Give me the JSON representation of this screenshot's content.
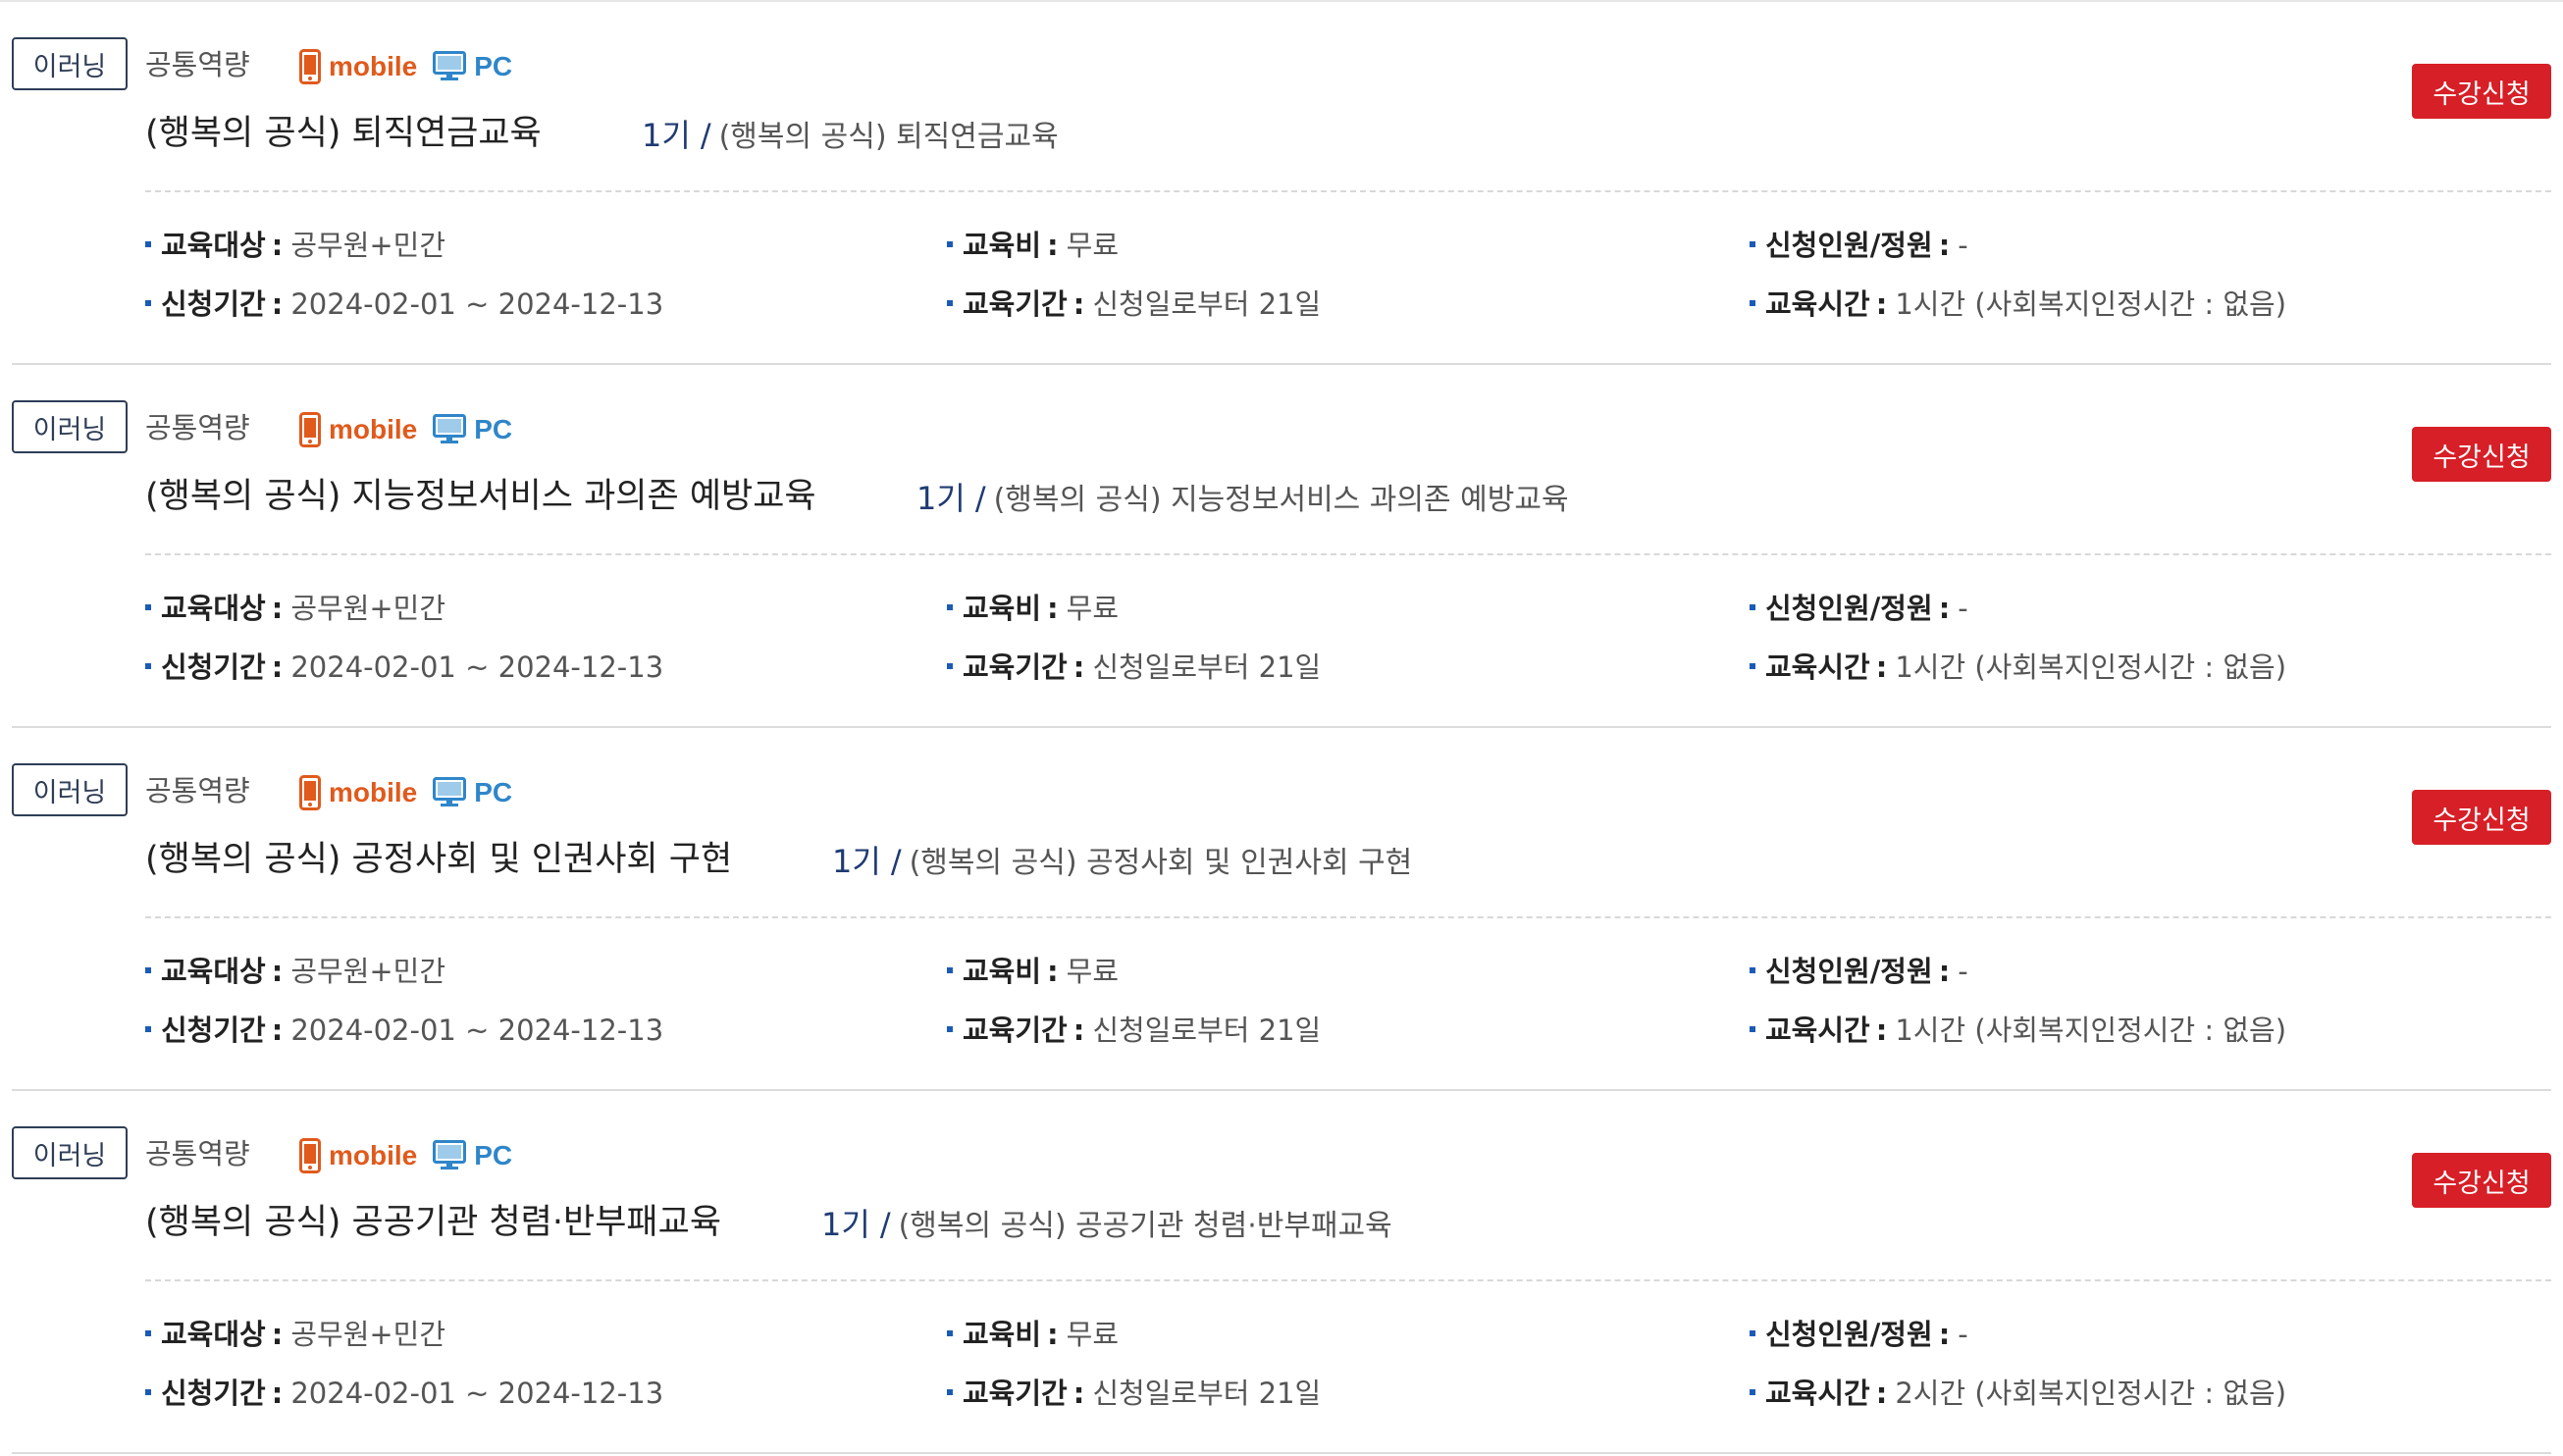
{
  "labels": {
    "target": "교육대상",
    "fee": "교육비",
    "capacity": "신청인원/정원",
    "apply_period": "신청기간",
    "edu_period": "교육기간",
    "edu_time": "교육시간",
    "colon": ":",
    "slash": "/"
  },
  "colors": {
    "apply_button": "#d71f27",
    "badge_border": "#2f3e57",
    "mobile": "#e05a1c",
    "pc": "#2f86c9",
    "bullet": "#1a5bb8"
  },
  "courses": [
    {
      "type_badge": "이러닝",
      "category": "공통역량",
      "device_mobile": "mobile",
      "device_pc": "PC",
      "title": "(행복의 공식) 퇴직연금교육",
      "round": "1기",
      "subtitle": "(행복의 공식) 퇴직연금교육",
      "apply_label": "수강신청",
      "target": "공무원+민간",
      "fee": "무료",
      "capacity": "-",
      "apply_period": "2024-02-01 ~ 2024-12-13",
      "edu_period": "신청일로부터 21일",
      "edu_time": "1시간 (사회복지인정시간 : 없음)"
    },
    {
      "type_badge": "이러닝",
      "category": "공통역량",
      "device_mobile": "mobile",
      "device_pc": "PC",
      "title": "(행복의 공식) 지능정보서비스 과의존 예방교육",
      "round": "1기",
      "subtitle": "(행복의 공식) 지능정보서비스 과의존 예방교육",
      "apply_label": "수강신청",
      "target": "공무원+민간",
      "fee": "무료",
      "capacity": "-",
      "apply_period": "2024-02-01 ~ 2024-12-13",
      "edu_period": "신청일로부터 21일",
      "edu_time": "1시간 (사회복지인정시간 : 없음)"
    },
    {
      "type_badge": "이러닝",
      "category": "공통역량",
      "device_mobile": "mobile",
      "device_pc": "PC",
      "title": "(행복의 공식) 공정사회 및 인권사회 구현",
      "round": "1기",
      "subtitle": "(행복의 공식) 공정사회 및 인권사회 구현",
      "apply_label": "수강신청",
      "target": "공무원+민간",
      "fee": "무료",
      "capacity": "-",
      "apply_period": "2024-02-01 ~ 2024-12-13",
      "edu_period": "신청일로부터 21일",
      "edu_time": "1시간 (사회복지인정시간 : 없음)"
    },
    {
      "type_badge": "이러닝",
      "category": "공통역량",
      "device_mobile": "mobile",
      "device_pc": "PC",
      "title": "(행복의 공식) 공공기관 청렴·반부패교육",
      "round": "1기",
      "subtitle": "(행복의 공식) 공공기관 청렴·반부패교육",
      "apply_label": "수강신청",
      "target": "공무원+민간",
      "fee": "무료",
      "capacity": "-",
      "apply_period": "2024-02-01 ~ 2024-12-13",
      "edu_period": "신청일로부터 21일",
      "edu_time": "2시간 (사회복지인정시간 : 없음)"
    }
  ]
}
